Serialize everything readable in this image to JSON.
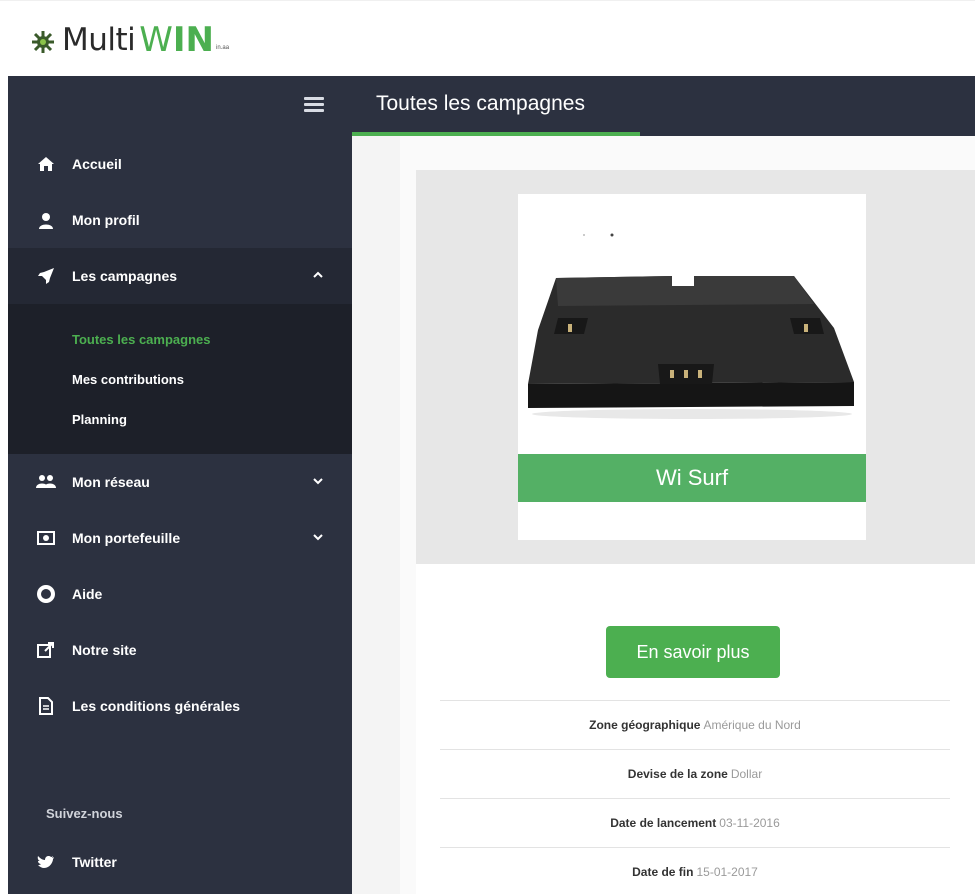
{
  "brand": {
    "logo_multi": "Multi",
    "logo_w": "W",
    "logo_in": "IN",
    "logo_sub": "in.aa",
    "accent": "#4caf50",
    "sidebar_bg": "#2c3140"
  },
  "header": {
    "title": "Toutes les campagnes"
  },
  "sidebar": {
    "items": [
      {
        "label": "Accueil",
        "icon": "home-icon"
      },
      {
        "label": "Mon profil",
        "icon": "user-icon"
      },
      {
        "label": "Les campagnes",
        "icon": "rocket-icon",
        "expanded": true
      },
      {
        "label": "Mon réseau",
        "icon": "group-icon"
      },
      {
        "label": "Mon portefeuille",
        "icon": "money-icon"
      },
      {
        "label": "Aide",
        "icon": "lifebuoy-icon"
      },
      {
        "label": "Notre site",
        "icon": "external-link-icon"
      },
      {
        "label": "Les conditions générales",
        "icon": "document-icon"
      }
    ],
    "submenu": [
      {
        "label": "Toutes les campagnes",
        "active": true
      },
      {
        "label": "Mes contributions"
      },
      {
        "label": "Planning"
      }
    ],
    "follow_label": "Suivez-nous",
    "social": [
      {
        "label": "Twitter",
        "icon": "twitter-icon"
      }
    ]
  },
  "campaign": {
    "name": "Wi Surf",
    "cta_label": "En savoir plus",
    "details": [
      {
        "key": "Zone géographique",
        "value": "Amérique du Nord"
      },
      {
        "key": "Devise de la zone",
        "value": "Dollar"
      },
      {
        "key": "Date de lancement",
        "value": "03-11-2016"
      },
      {
        "key": "Date de fin",
        "value": "15-01-2017"
      }
    ]
  }
}
